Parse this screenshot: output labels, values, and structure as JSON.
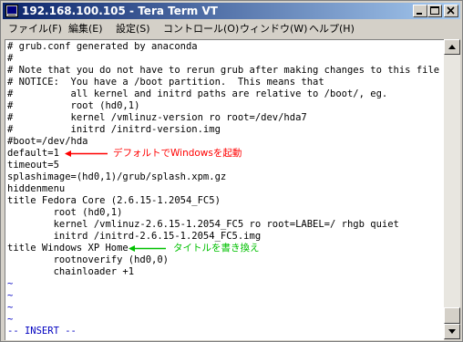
{
  "window": {
    "title": "192.168.100.105 - Tera Term VT"
  },
  "menu": [
    {
      "label": "ファイル(F)"
    },
    {
      "label": "編集(E)"
    },
    {
      "label": "設定(S)"
    },
    {
      "label": "コントロール(O)"
    },
    {
      "label": "ウィンドウ(W)"
    },
    {
      "label": "ヘルプ(H)"
    }
  ],
  "terminal": {
    "lines": [
      "# grub.conf generated by anaconda",
      "#",
      "# Note that you do not have to rerun grub after making changes to this file",
      "# NOTICE:  You have a /boot partition.  This means that",
      "#          all kernel and initrd paths are relative to /boot/, eg.",
      "#          root (hd0,1)",
      "#          kernel /vmlinuz-version ro root=/dev/hda7",
      "#          initrd /initrd-version.img",
      "#boot=/dev/hda",
      "default=1",
      "timeout=5",
      "splashimage=(hd0,1)/grub/splash.xpm.gz",
      "hiddenmenu",
      "title Fedora Core (2.6.15-1.2054_FC5)",
      "        root (hd0,1)",
      "        kernel /vmlinuz-2.6.15-1.2054_FC5 ro root=LABEL=/ rhgb quiet",
      "        initrd /initrd-2.6.15-1.2054_FC5.img",
      "title Windows XP Home",
      "        rootnoverify (hd0,0)",
      "        chainloader +1",
      "~",
      "~",
      "~",
      "~"
    ],
    "status_line": "-- INSERT --"
  },
  "annotations": [
    {
      "text": "デフォルトでWindowsを起動",
      "color": "#ff0000"
    },
    {
      "text": "タイトルを書き換え",
      "color": "#00c000"
    }
  ],
  "icons": {
    "app": "tera-term-icon",
    "minimize": "minimize-icon",
    "maximize": "maximize-icon",
    "close": "close-icon",
    "scroll_up": "scroll-up-arrow-icon",
    "scroll_down": "scroll-down-arrow-icon"
  },
  "colors": {
    "title_start": "#0a246a",
    "title_end": "#a6caf0",
    "window_face": "#d4d0c8",
    "terminal_bg": "#ffffff",
    "tilde": "#0000c0",
    "annotation_red": "#ff0000",
    "annotation_green": "#00c000"
  }
}
